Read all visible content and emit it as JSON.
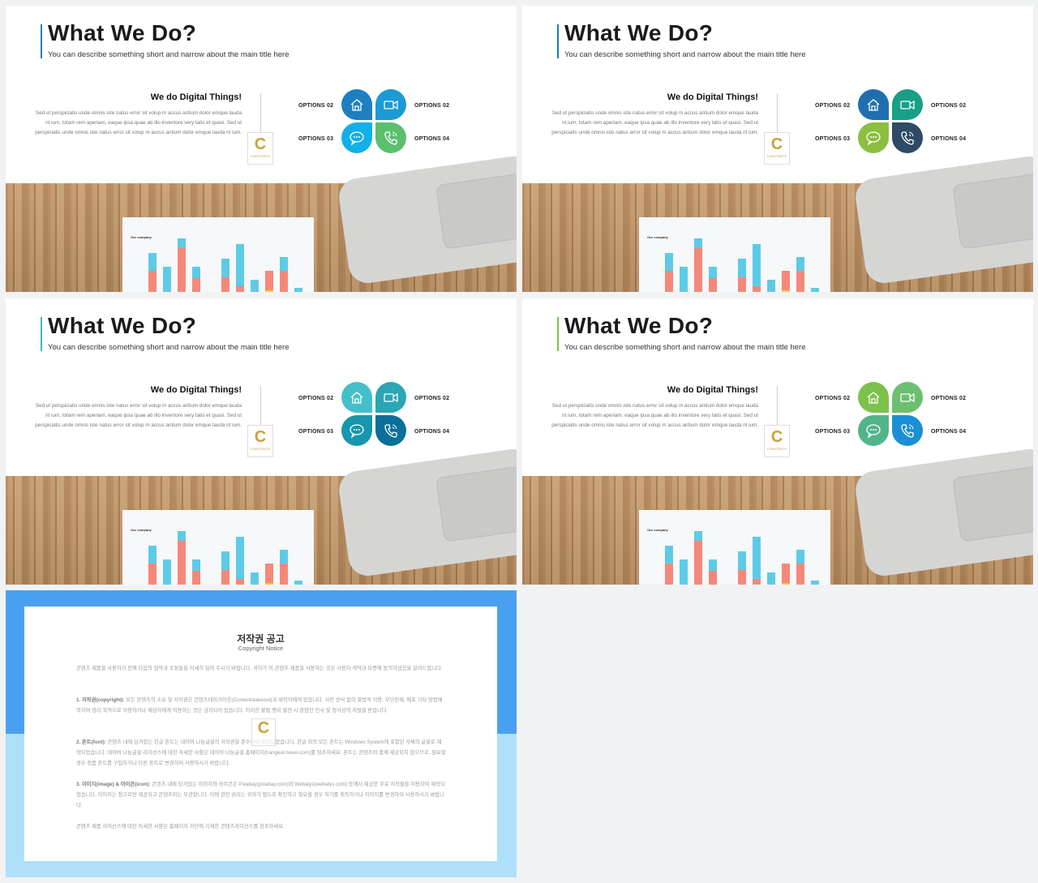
{
  "slides": [
    {
      "accent": "#1a7fc0",
      "title": "What We Do?",
      "subtitle": "You can describe something short and narrow about the main title here",
      "heading": "We do Digital Things!",
      "body": "Sed ut perspiciatis unde omnis iste natus error sit volup m accus antium dolor emque lauda nt ium, totam rem aperiam, eaque ipsa quae ab illo inventore very tatis et quasi. Sed ut perspiciatis unde omnis iste natus error sit volup m accus antium dolor emque lauda nt ium.",
      "logo": "C",
      "logo_text": "CONTENTS",
      "options": [
        "OPTIONS 02",
        "OPTIONS 02",
        "OPTIONS 03",
        "OPTIONS 04"
      ],
      "petal_colors": [
        "#1e7fc0",
        "#1a9ad6",
        "#12b0e8",
        "#5bbf6e"
      ],
      "photo_label": "Our company"
    },
    {
      "accent": "#1a7fc0",
      "title": "What We Do?",
      "subtitle": "You can describe something short and narrow about the main title here",
      "heading": "We do Digital Things!",
      "body": "Sed ut perspiciatis unde omnis iste natus error sit volup m accus antium dolor emque lauda nt ium, totam rem aperiam, eaque ipsa quae ab illo inventore very tatis et quasi. Sed ut perspiciatis unde omnis iste natus error sit volup m accus antium dolor emque lauda nt ium.",
      "logo": "C",
      "logo_text": "CONTENTS",
      "options": [
        "OPTIONS 02",
        "OPTIONS 02",
        "OPTIONS 03",
        "OPTIONS 04"
      ],
      "petal_colors": [
        "#1f6fb0",
        "#17a085",
        "#8cbf3f",
        "#2e4a66"
      ],
      "photo_label": "Our company"
    },
    {
      "accent": "#3bb8c4",
      "title": "What We Do?",
      "subtitle": "You can describe something short and narrow about the main title here",
      "heading": "We do Digital Things!",
      "body": "Sed ut perspiciatis unde omnis iste natus error sit volup m accus antium dolor emque lauda nt ium, totam rem aperiam, eaque ipsa quae ab illo inventore very tatis et quasi. Sed ut perspiciatis unde omnis iste natus error sit volup m accus antium dolor emque lauda nt ium.",
      "logo": "C",
      "logo_text": "CONTENTS",
      "options": [
        "OPTIONS 02",
        "OPTIONS 02",
        "OPTIONS 03",
        "OPTIONS 04"
      ],
      "petal_colors": [
        "#45bfc7",
        "#2aa6b5",
        "#1796ad",
        "#0a6f99"
      ],
      "photo_label": "Our company"
    },
    {
      "accent": "#7dc14a",
      "title": "What We Do?",
      "subtitle": "You can describe something short and narrow about the main title here",
      "heading": "We do Digital Things!",
      "body": "Sed ut perspiciatis unde omnis iste natus error sit volup m accus antium dolor emque lauda nt ium, totam rem aperiam, eaque ipsa quae ab illo inventore very tatis et quasi. Sed ut perspiciatis unde omnis iste natus error sit volup m accus antium dolor emque lauda nt ium.",
      "logo": "C",
      "logo_text": "CONTENTS",
      "options": [
        "OPTIONS 02",
        "OPTIONS 02",
        "OPTIONS 03",
        "OPTIONS 04"
      ],
      "petal_colors": [
        "#7dc14a",
        "#6cbf6f",
        "#52b58a",
        "#1b8fd6"
      ],
      "photo_label": "Our company"
    }
  ],
  "petal_icons": [
    "home-icon",
    "video-camera-icon",
    "chat-bubble-icon",
    "phone-icon"
  ],
  "copyright": {
    "title": "저작권 공고",
    "subtitle": "Copyright Notice",
    "intro": "콘텐츠 제품을 사용하기 전에 다음의 협약과 조항들을 자세히 읽어 주시기 바랍니다. 귀하가 이 콘텐츠 제품을 사용하는 것은 사용자 계약과 보증에 동의하셨음을 알려드립니다.",
    "s1_label": "1. 저작권(copyright):",
    "s1": " 모든 콘텐츠의 소유 및 저작권은 콘텐츠테이크아웃(Contentstakeout)과 제작자에게 있습니다. 사전 승낙 없이 불법적 이용, 무단전재, 배포 기타 방법에 의하여 영리 목적으로 이용하거나 제삼자에게 이용하는 것은 금지되어 있습니다. 이러한 불법 행위 발견 시 준엄한 민사 및 형사상의 처벌을 받습니다.",
    "s2_label": "2. 폰트(font):",
    "s2": " 콘텐츠 내에 담겨있는 한글 폰트는 네이버 나눔글꼴의 저작권을 준수하여 제작되었습니다. 한글 외의 모든 폰트는 Windows System에 포함된 자체의 글꼴로 제작되었습니다. 네이버 나눔글꼴 라이선스에 대한 자세한 사항은 네이버 나눔글꼴 홈페이지(hangeul.naver.com)를 참조하세요. 폰트는 콘텐츠와 함께 제공되지 않으므로, 필요할 경우 정품 폰트를 구입하거나 다른 폰트로 변경하여 사용하시기 바랍니다.",
    "s3_label": "3. 이미지(image) & 아이콘(icon):",
    "s3": " 콘텐츠 내에 담겨있는 이미지와 아이콘은 Pixabay(pixabay.com)와 Webalys(webalys.com) 등에서 제공한 무료 저작물을 이용하여 제작되었습니다. 이미지는 참고로만 제공되고 콘텐츠와는 무관합니다. 이에 관한 권리는 귀하가 별도로 확인하고 필요할 경우 허가를 취득하거나 이미지를 변경하여 사용하시기 바랍니다.",
    "outro": "콘텐츠 제품 라이선스에 대한 자세한 사항은 홈페이지 하단에 기재한 콘텐츠라이선스를 참조하세요.",
    "logo": "C"
  }
}
